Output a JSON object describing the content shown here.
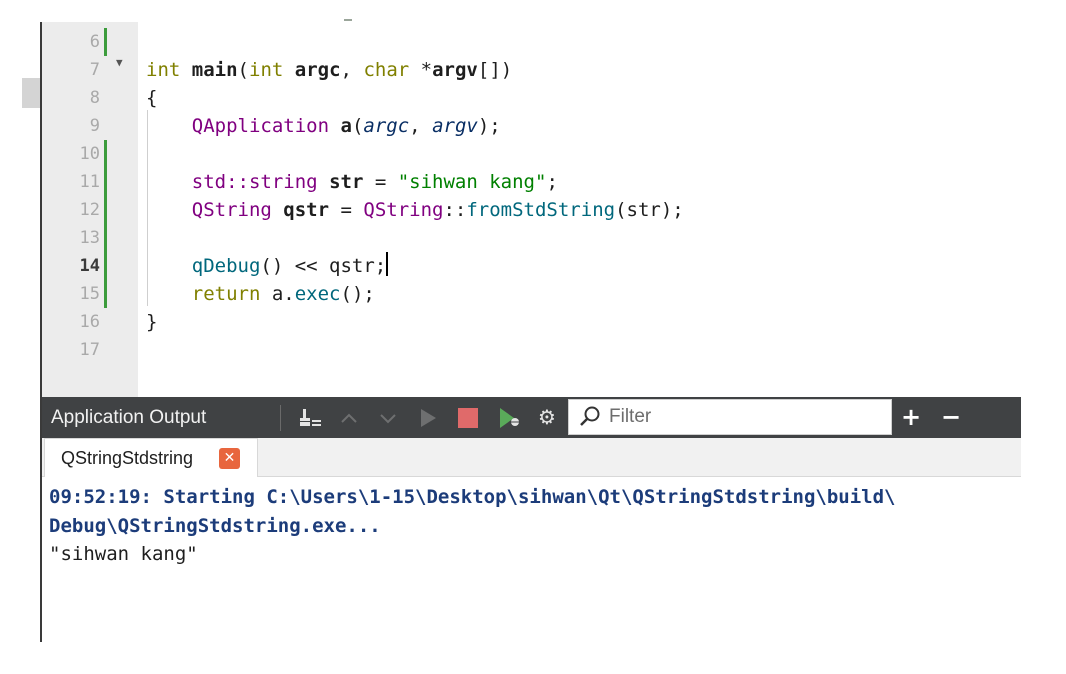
{
  "editor": {
    "line_numbers": [
      "6",
      "7",
      "8",
      "9",
      "10",
      "11",
      "12",
      "13",
      "14",
      "15",
      "16",
      "17"
    ],
    "current_line": "14",
    "code": {
      "l7": {
        "kw_int": "int",
        "fn_main": "main",
        "p1": "(",
        "kw_int2": "int",
        "argc": "argc",
        "comma": ", ",
        "kw_char": "char",
        "star": "*",
        "argv": "argv",
        "tail": "[])"
      },
      "l8": {
        "brace": "{"
      },
      "l9": {
        "type": "QApplication",
        "var": "a",
        "p1": "(",
        "a1": "argc",
        "comma": ", ",
        "a2": "argv",
        "tail": ");"
      },
      "l11": {
        "ns": "std::string",
        "var": "str",
        "eq": " = ",
        "str": "\"sihwan kang\"",
        "tail": ";"
      },
      "l12": {
        "type": "QString",
        "var": "qstr",
        "eq": " = ",
        "type2": "QString",
        "colons": "::",
        "fn": "fromStdString",
        "tail": "(str);"
      },
      "l14": {
        "fn": "qDebug",
        "mid": "() << qstr;"
      },
      "l15": {
        "kw": "return",
        "mid": " a.",
        "fn": "exec",
        "tail": "();"
      },
      "l16": {
        "brace": "}"
      }
    }
  },
  "output_pane": {
    "title": "Application Output",
    "filter_placeholder": "Filter",
    "icons": [
      "clean-icon",
      "scroll-up-icon",
      "scroll-down-icon",
      "run-icon",
      "stop-icon",
      "debug-icon",
      "settings-icon",
      "search-icon",
      "plus-icon",
      "minus-icon"
    ],
    "tab": {
      "label": "QStringStdstring"
    },
    "lines": [
      "09:52:19: Starting C:\\Users\\1-15\\Desktop\\sihwan\\Qt\\QStringStdstring\\build\\",
      "Debug\\QStringStdstring.exe...",
      "\"sihwan kang\""
    ]
  },
  "colors": {
    "accent_changed": "#3c9c3c",
    "stop_red": "#e06a6a",
    "tab_close": "#e8663e",
    "pane_bar": "#404244"
  }
}
